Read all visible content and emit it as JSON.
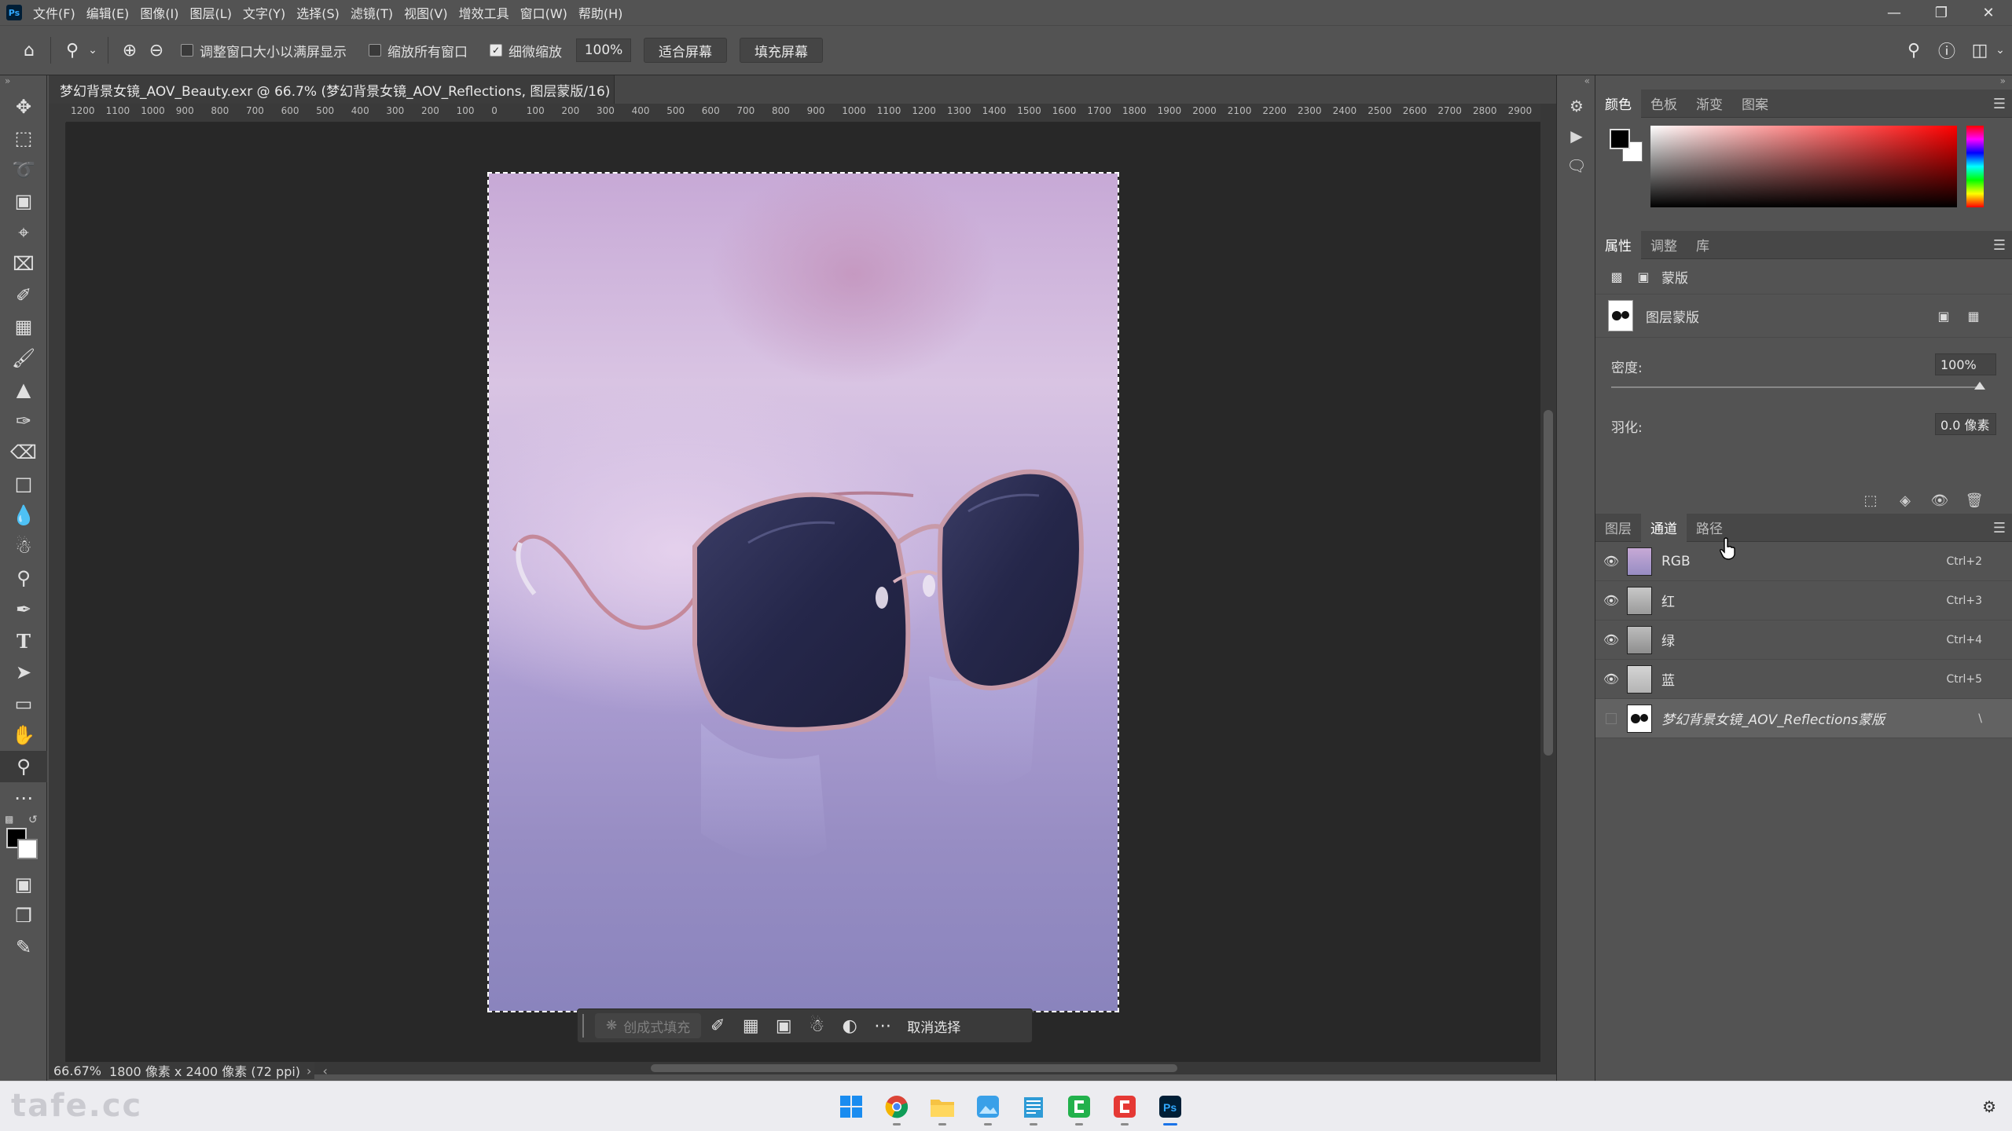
{
  "menu": {
    "items": [
      "文件(F)",
      "编辑(E)",
      "图像(I)",
      "图层(L)",
      "文字(Y)",
      "选择(S)",
      "滤镜(T)",
      "视图(V)",
      "增效工具",
      "窗口(W)",
      "帮助(H)"
    ]
  },
  "options": {
    "resize_windows": "调整窗口大小以满屏显示",
    "zoom_all": "缩放所有窗口",
    "scrubby_zoom": "细微缩放",
    "zoom_value": "100%",
    "fit_screen": "适合屏幕",
    "fill_screen": "填充屏幕"
  },
  "document": {
    "tab_title": "梦幻背景女镜_AOV_Beauty.exr @ 66.7% (梦幻背景女镜_AOV_Reflections, 图层蒙版/16) *",
    "close": "×"
  },
  "ruler": {
    "ticks": [
      "1200",
      "1100",
      "1000",
      "900",
      "800",
      "700",
      "600",
      "500",
      "400",
      "300",
      "200",
      "100",
      "0",
      "100",
      "200",
      "300",
      "400",
      "500",
      "600",
      "700",
      "800",
      "900",
      "1000",
      "1100",
      "1200",
      "1300",
      "1400",
      "1500",
      "1600",
      "1700",
      "1800",
      "1900",
      "2000",
      "2100",
      "2200",
      "2300",
      "2400",
      "2500",
      "2600",
      "2700",
      "2800",
      "2900"
    ]
  },
  "context_bar": {
    "generative_fill": "创成式填充",
    "deselect": "取消选择"
  },
  "status": {
    "zoom": "66.67%",
    "doc_info": "1800 像素 x 2400 像素 (72 ppi)"
  },
  "color_panel": {
    "tabs": [
      "颜色",
      "色板",
      "渐变",
      "图案"
    ]
  },
  "properties_panel": {
    "tabs": [
      "属性",
      "调整",
      "库"
    ],
    "mask_section": "蒙版",
    "layer_mask": "图层蒙版",
    "density_label": "密度:",
    "density_value": "100%",
    "density": 1.0,
    "feather_label": "羽化:",
    "feather_value": "0.0 像素"
  },
  "channels_panel": {
    "tabs": [
      "图层",
      "通道",
      "路径"
    ],
    "channels": [
      {
        "name": "RGB",
        "shortcut": "Ctrl+2"
      },
      {
        "name": "红",
        "shortcut": "Ctrl+3"
      },
      {
        "name": "绿",
        "shortcut": "Ctrl+4"
      },
      {
        "name": "蓝",
        "shortcut": "Ctrl+5"
      },
      {
        "name": "梦幻背景女镜_AOV_Reflections蒙版",
        "shortcut": "\\"
      }
    ]
  },
  "taskbar": {
    "watermark": "tafe.cc",
    "apps": [
      "windows-start",
      "chrome",
      "file-explorer",
      "photos",
      "notepad",
      "app-green",
      "app-red",
      "photoshop"
    ]
  },
  "icons": {
    "ps_logo": "Ps"
  }
}
